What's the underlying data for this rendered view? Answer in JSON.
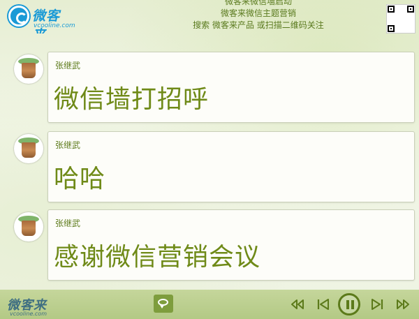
{
  "header": {
    "logo_text": "微客来",
    "logo_sub": "vcooline.com",
    "marquee": [
      "微客来微信墙启动",
      "微客来微信主题营销",
      "搜索 微客来产品 或扫描二维码关注"
    ]
  },
  "messages": [
    {
      "sender": "张继武",
      "content": "微信墙打招呼"
    },
    {
      "sender": "张继武",
      "content": "哈哈"
    },
    {
      "sender": "张继武",
      "content": "感谢微信营销会议"
    }
  ],
  "footer": {
    "logo_text": "微客来",
    "logo_sub": "vcooline.com",
    "controls": [
      "rewind-icon",
      "previous-icon",
      "pause-icon",
      "next-icon",
      "fast-forward-icon"
    ]
  },
  "colors": {
    "accent_green": "#6f8a18",
    "brand_blue": "#1a9ad6",
    "footer_bg": "#b3c985"
  }
}
